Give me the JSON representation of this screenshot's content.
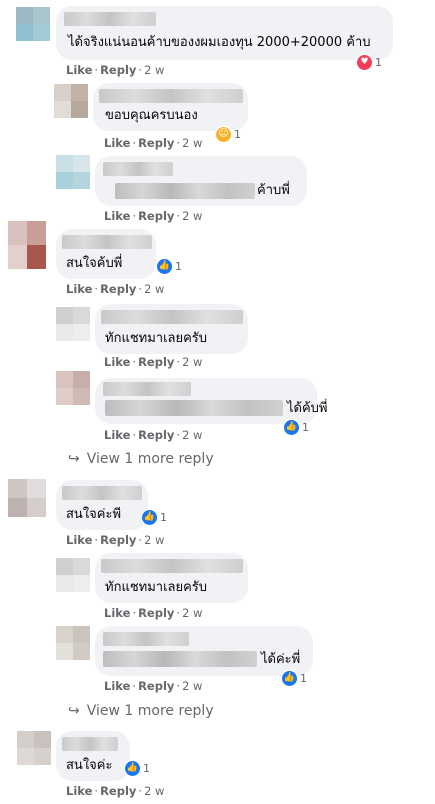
{
  "action_like": "Like",
  "action_reply": "Reply",
  "time": "2 w",
  "view_more": "View 1 more reply",
  "comments": [
    {
      "text": "ได้จริงแน่นอนค้าบของงผมเองทุน 2000+20000 ค้าบ",
      "reaction": {
        "icon": "heart-icon",
        "count": "1"
      }
    },
    {
      "text": "ขอบคุณครบนอง",
      "reaction": {
        "icon": "haha-icon",
        "count": "1"
      }
    },
    {
      "text_tail": "ค้าบพี่"
    },
    {
      "text": "สนใจค้บพี่",
      "reaction": {
        "icon": "like-icon",
        "count": "1"
      }
    },
    {
      "text": "ทักแชทมาเลยครับ"
    },
    {
      "text_tail": "ได้ค้บพี่",
      "reaction": {
        "icon": "like-icon",
        "count": "1"
      }
    },
    {
      "text": "สนใจค่ะพี",
      "reaction": {
        "icon": "like-icon",
        "count": "1"
      }
    },
    {
      "text": "ทักแชทมาเลยครับ"
    },
    {
      "text_tail": "ได้ค่ะพี่",
      "reaction": {
        "icon": "like-icon",
        "count": "1"
      }
    },
    {
      "text": "สนใจค่ะ",
      "reaction": {
        "icon": "like-icon",
        "count": "1"
      }
    }
  ],
  "colors": {
    "like": "#1877f2",
    "heart": "#f33e58",
    "haha": "#f7b125",
    "bubble": "#f0f2f5",
    "meta": "#65676b"
  }
}
